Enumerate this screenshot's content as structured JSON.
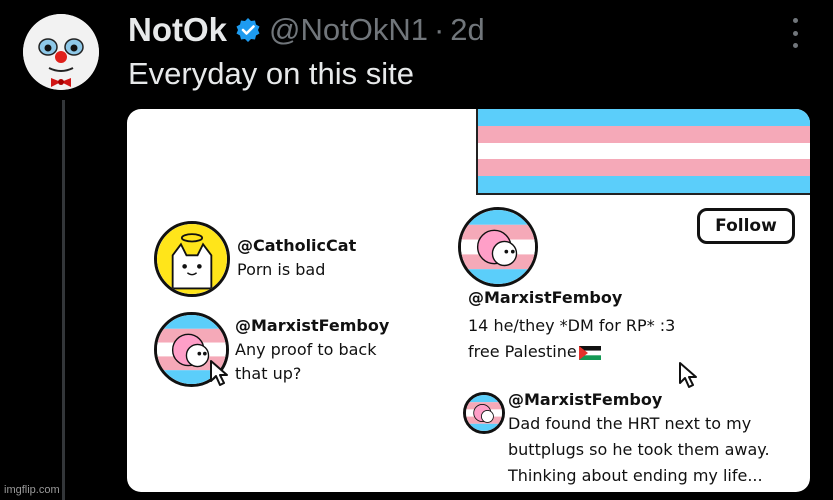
{
  "tweet": {
    "display_name": "NotOk",
    "handle": "@NotOkN1",
    "separator": "·",
    "time": "2d",
    "text": "Everyday on this site",
    "avatar_icon": "clown-icon",
    "verified_icon": "verified-badge-icon",
    "more_icon": "more-options-icon"
  },
  "comic": {
    "flag_colors": [
      "#5bcefa",
      "#f5a9b8",
      "#ffffff",
      "#f5a9b8",
      "#5bcefa"
    ],
    "follow_label": "Follow",
    "left_panel": {
      "post1": {
        "handle": "@CatholicCat",
        "lines": [
          "Porn is bad"
        ]
      },
      "post2": {
        "handle": "@MarxistFemboy",
        "lines": [
          "Any proof to back",
          "that up?"
        ]
      }
    },
    "profile": {
      "handle": "@MarxistFemboy",
      "bio_line1": "14 he/they *DM for RP* :3",
      "bio_line2": "free Palestine"
    },
    "reply": {
      "handle": "@MarxistFemboy",
      "lines": [
        "Dad found the HRT next to my",
        "buttplugs so he took them away.",
        "Thinking about ending my life..."
      ]
    }
  },
  "watermark": "imgflip.com"
}
